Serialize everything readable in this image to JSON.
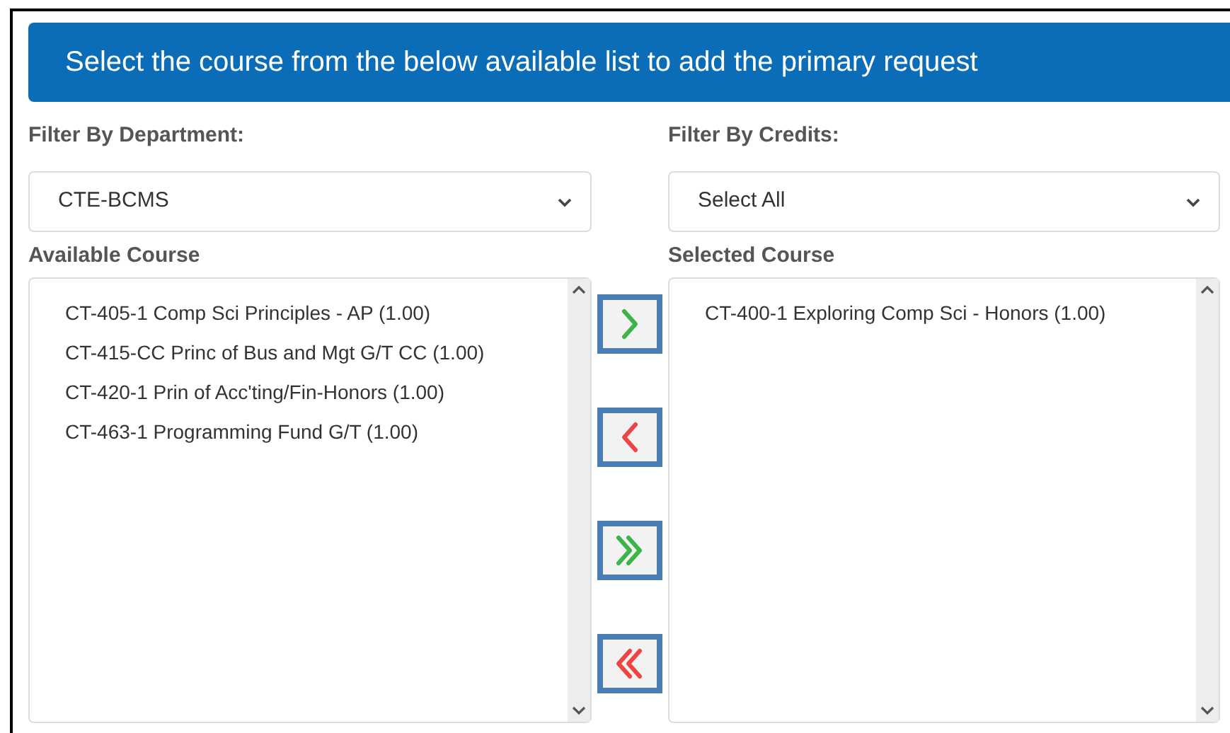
{
  "banner": {
    "title": "Select the course from the below available list to add the primary request"
  },
  "department_filter": {
    "label": "Filter By Department:",
    "value": "CTE-BCMS"
  },
  "credits_filter": {
    "label": "Filter By Credits:",
    "value": "Select All"
  },
  "available_course": {
    "label": "Available Course",
    "items": [
      "CT-405-1 Comp Sci Principles - AP (1.00)",
      "CT-415-CC Princ of Bus and Mgt G/T CC (1.00)",
      "CT-420-1 Prin of Acc'ting/Fin-Honors (1.00)",
      "CT-463-1 Programming Fund G/T (1.00)"
    ]
  },
  "transfer_buttons": [
    {
      "kind": "add"
    },
    {
      "kind": "remove"
    },
    {
      "kind": "add_all"
    },
    {
      "kind": "remove_all"
    }
  ],
  "selected_course": {
    "label": "Selected Course",
    "items": [
      "CT-400-1 Exploring Comp Sci - Honors (1.00)"
    ]
  }
}
